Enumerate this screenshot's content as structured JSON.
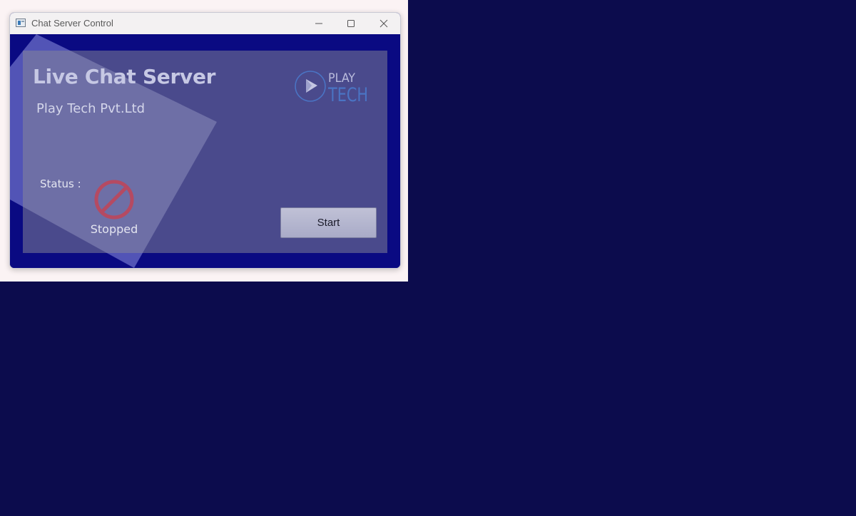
{
  "window": {
    "title": "Chat Server Control",
    "icon": "app-window-icon",
    "controls": [
      "minimize-icon",
      "maximize-icon",
      "close-icon"
    ]
  },
  "header": {
    "title": "Live Chat Server",
    "company": "Play Tech Pvt.Ltd"
  },
  "logo": {
    "line1": "PLAY",
    "line2": "TECH",
    "icon": "play-icon"
  },
  "status": {
    "label": "Status :",
    "value": "Stopped",
    "icon": "prohibited-icon"
  },
  "actions": {
    "start_label": "Start"
  },
  "colors": {
    "desktop": "#0c0c4d",
    "client_background": "#0a0a82",
    "logo_play": "#b9bbdc",
    "logo_tech": "#4a74c4",
    "stopped_icon": "#b54a62"
  }
}
